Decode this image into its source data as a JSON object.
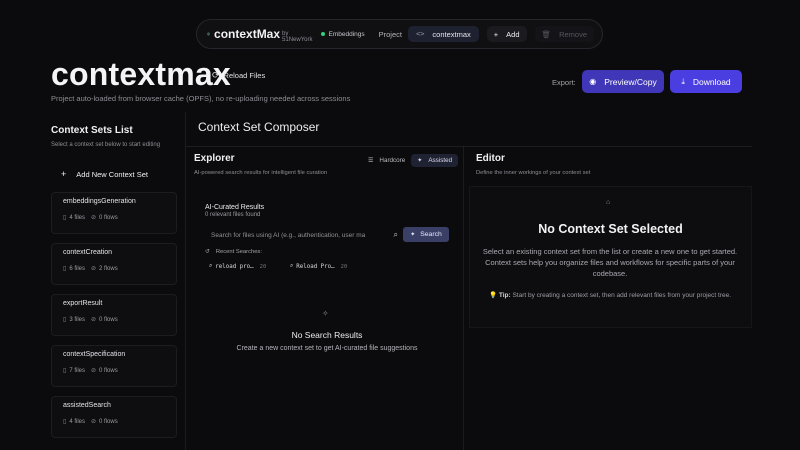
{
  "nav": {
    "brand": "contextMax",
    "brand_by": "by 51NewYork",
    "embeddings": "Embeddings",
    "project_label": "Project",
    "project_name": "contextmax",
    "add_label": "Add",
    "remove_label": "Remove"
  },
  "header": {
    "title": "contextmax",
    "reload_label": "Reload Files",
    "subtitle": "Project auto-loaded from browser cache (OPFS), no re-uploading needed across sessions",
    "export_label": "Export:",
    "preview_label": "Preview/Copy",
    "download_label": "Download"
  },
  "sidebar": {
    "title": "Context Sets List",
    "subtitle": "Select a context set below to start editing",
    "add_label": "Add New Context Set",
    "sets": [
      {
        "name": "embeddingsGeneration",
        "files": "4 files",
        "flows": "0 flows"
      },
      {
        "name": "contextCreation",
        "files": "6 files",
        "flows": "2 flows"
      },
      {
        "name": "exportResult",
        "files": "3 files",
        "flows": "0 flows"
      },
      {
        "name": "contextSpecification",
        "files": "7 files",
        "flows": "0 flows"
      },
      {
        "name": "assistedSearch",
        "files": "4 files",
        "flows": "0 flows"
      }
    ]
  },
  "composer": {
    "title": "Context Set Composer"
  },
  "explorer": {
    "title": "Explorer",
    "subtitle": "AI-powered search results for intelligent file curation",
    "mode_hardcore": "Hardcore",
    "mode_assisted": "Assisted",
    "ai_title": "AI-Curated Results",
    "ai_count": "0 relevant files found",
    "search_placeholder": "Search for files using AI (e.g., authentication, user ma",
    "search_button": "Search",
    "recent_label": "Recent Searches:",
    "recent": [
      {
        "query": "reload pro…",
        "count": "20"
      },
      {
        "query": "Reload Pro…",
        "count": "20"
      }
    ],
    "empty_title": "No Search Results",
    "empty_sub": "Create a new context set to get AI-curated file suggestions"
  },
  "editor": {
    "title": "Editor",
    "subtitle": "Define the inner workings of your context set",
    "empty_title": "No Context Set Selected",
    "empty_desc": "Select an existing context set from the list or create a new one to get started. Context sets help you organize files and workflows for specific parts of your codebase.",
    "tip_label": "Tip:",
    "tip_text": "Start by creating a context set, then add relevant files from your project tree."
  }
}
